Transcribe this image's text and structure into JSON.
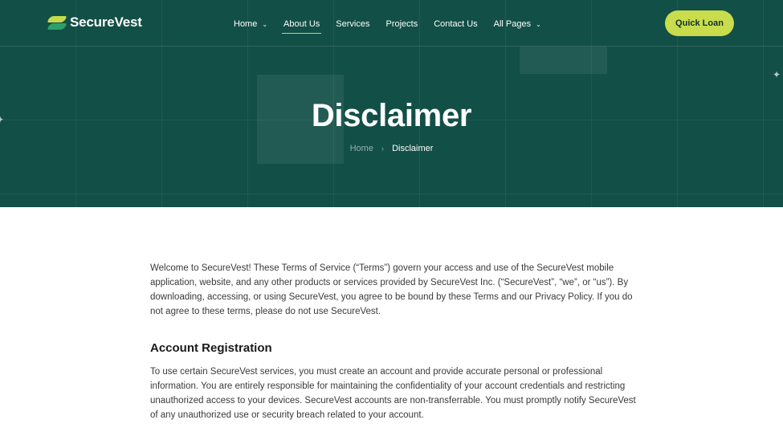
{
  "header": {
    "brand": "SecureVest",
    "nav": [
      {
        "label": "Home",
        "chevron": "chevron-down-icon"
      },
      {
        "label": "About Us"
      },
      {
        "label": "Services"
      },
      {
        "label": "Projects"
      },
      {
        "label": "Contact Us"
      },
      {
        "label": "All Pages",
        "chevron": "chevron-down-icon"
      }
    ],
    "cta_label": "Quick Loan"
  },
  "hero": {
    "title": "Disclaimer",
    "breadcrumb": {
      "home": "Home",
      "current": "Disclaimer"
    }
  },
  "content": {
    "intro": "Welcome to SecureVest! These Terms of Service (“Terms”) govern your access and use of the SecureVest mobile application, website, and any other products or services provided by SecureVest Inc. (“SecureVest”, “we”, or “us”). By downloading, accessing, or using SecureVest, you agree to be bound by these Terms and our Privacy Policy. If you do not agree to these terms, please do not use SecureVest.",
    "sections": [
      {
        "heading": "Account Registration",
        "body": "To use certain SecureVest services, you must create an account and provide accurate personal or professional information. You are entirely responsible for maintaining the confidentiality of your account credentials and restricting unauthorized access to your devices. SecureVest accounts are non-transferrable. You must promptly notify SecureVest of any unauthorized use or security breach related to your account."
      }
    ]
  },
  "colors": {
    "hero_bg": "#124f47",
    "accent": "#c8dc4c",
    "logo_green": "#2ea06a"
  }
}
